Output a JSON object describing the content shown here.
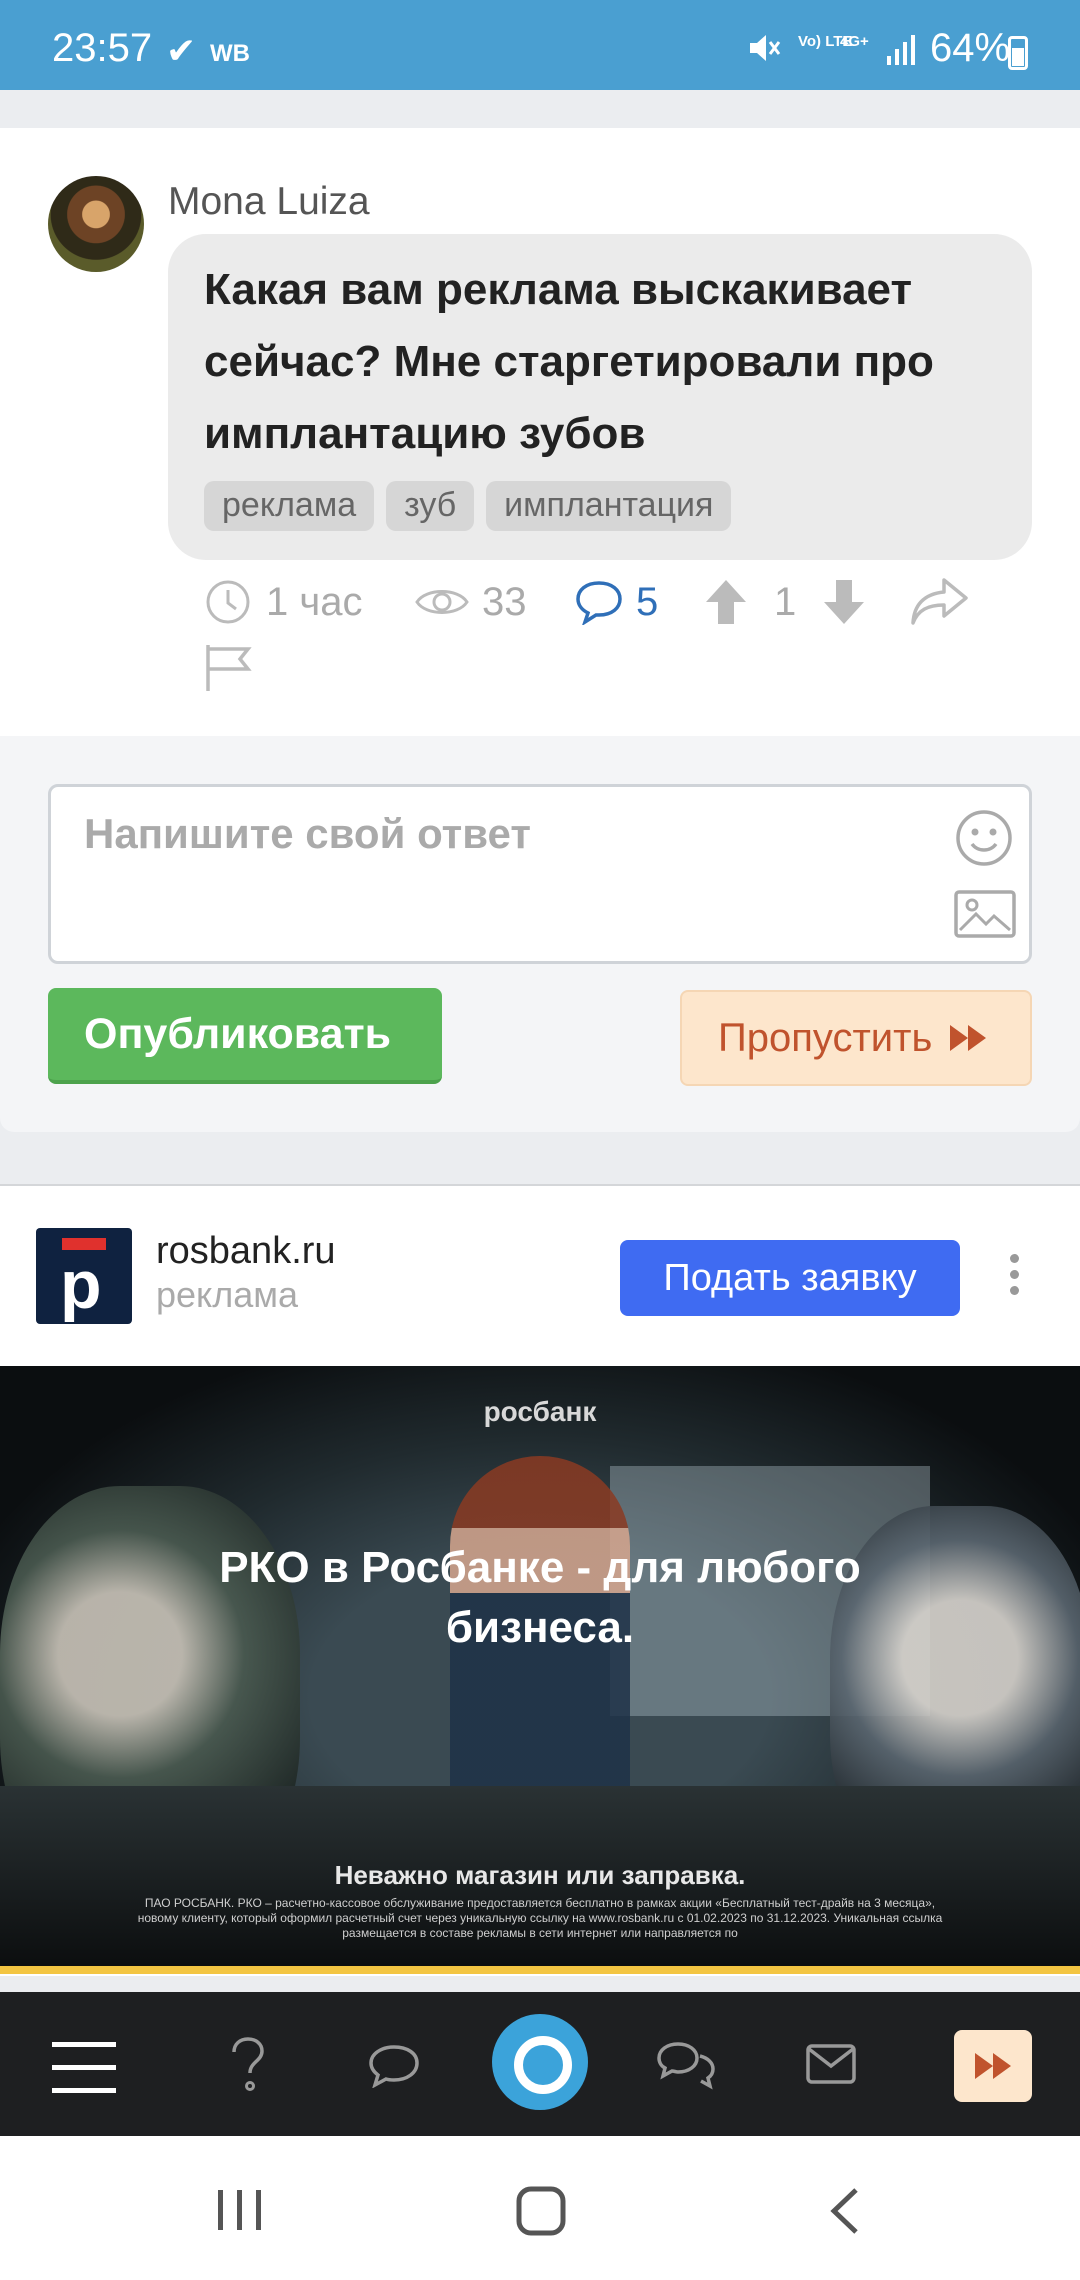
{
  "status_bar": {
    "time": "23:57",
    "check": "✔",
    "carrier_badge": "WB",
    "volte": "Vo) LTE",
    "network": "4G+",
    "battery": "64%"
  },
  "post": {
    "author": "Mona Luiza",
    "question": "Какая вам реклама выскакивает сейчас? Мне старгетировали про имплантацию зубов",
    "tags": [
      "реклама",
      "зуб",
      "имплантация"
    ],
    "time_ago": "1 час",
    "views": "33",
    "comments": "5",
    "votes": "1"
  },
  "answer": {
    "placeholder": "Напишите свой ответ",
    "publish_label": "Опубликовать",
    "skip_label": "Пропустить"
  },
  "ad": {
    "domain": "rosbank.ru",
    "label": "реклама",
    "cta": "Подать заявку",
    "brand": "росбанк",
    "headline": "РКО в Росбанке - для любого бизнеса.",
    "subtitle": "Неважно магазин или заправка.",
    "legal": "ПАО РОСБАНК. РКО – расчетно-кассовое обслуживание предоставляется бесплатно в рамках акции «Бесплатный тест-драйв на 3 месяца», новому клиенту, который оформил расчетный счет через уникальную ссылку на www.rosbank.ru с 01.02.2023 по 31.12.2023. Уникальная ссылка размещается в составе рекламы в сети интернет или направляется по"
  },
  "colors": {
    "status_bar": "#4a9fd1",
    "publish": "#5cb85c",
    "skip_bg": "#fde6cc",
    "skip_text": "#c0532d",
    "ad_button": "#3f6bf2",
    "comments_accent": "#2f6fb8"
  }
}
